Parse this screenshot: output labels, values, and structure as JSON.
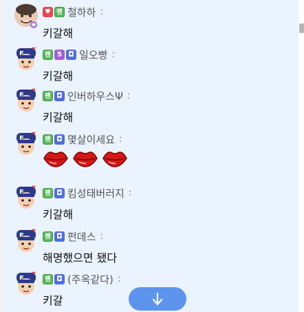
{
  "messages": [
    {
      "avatar": "profile-photo",
      "badges": [
        "red-heart-badge",
        "fan-badge"
      ],
      "badge_labels": {
        "fan-badge": "팬"
      },
      "nickname": "철하하",
      "colon": ":",
      "text": "키갈해"
    },
    {
      "avatar": "f-character",
      "badges": [
        "fan-badge",
        "level-5-badge",
        "blue-badge"
      ],
      "badge_labels": {
        "fan-badge": "팬",
        "level-5-badge": "5"
      },
      "nickname": "일오빵",
      "colon": ":",
      "text": "키갈해"
    },
    {
      "avatar": "f-character",
      "badges": [
        "fan-badge",
        "blue-badge"
      ],
      "badge_labels": {
        "fan-badge": "팬"
      },
      "nickname": "인버하우스Ψ",
      "colon": ":",
      "text": "키갈해"
    },
    {
      "avatar": "f-character",
      "badges": [
        "fan-badge",
        "blue-badge"
      ],
      "badge_labels": {
        "fan-badge": "팬"
      },
      "nickname": "몇살이세요",
      "colon": ":",
      "emoji": [
        "lips-icon",
        "lips-icon",
        "lips-icon"
      ]
    },
    {
      "avatar": "f-character",
      "badges": [
        "fan-badge",
        "blue-badge"
      ],
      "badge_labels": {
        "fan-badge": "팬"
      },
      "nickname": "킴성태버러지",
      "colon": ":",
      "text": "키갈해"
    },
    {
      "avatar": "f-character",
      "badges": [
        "fan-badge",
        "blue-badge"
      ],
      "badge_labels": {
        "fan-badge": "팬"
      },
      "nickname": "펀데스",
      "colon": ":",
      "text": "해명했으면 됐다"
    },
    {
      "avatar": "f-character",
      "badges": [
        "fan-badge",
        "blue-badge"
      ],
      "badge_labels": {
        "fan-badge": "팬"
      },
      "nickname": "(주옥같다)",
      "colon": ":",
      "text": "키갈"
    }
  ],
  "scroll_down_button": {
    "icon": "arrow-down-icon"
  },
  "colors": {
    "panel_bg": "#eaf3fe",
    "button_bg": "#5d95ee",
    "fan_badge": "#5cb85c",
    "blue_badge": "#4f6de0"
  }
}
